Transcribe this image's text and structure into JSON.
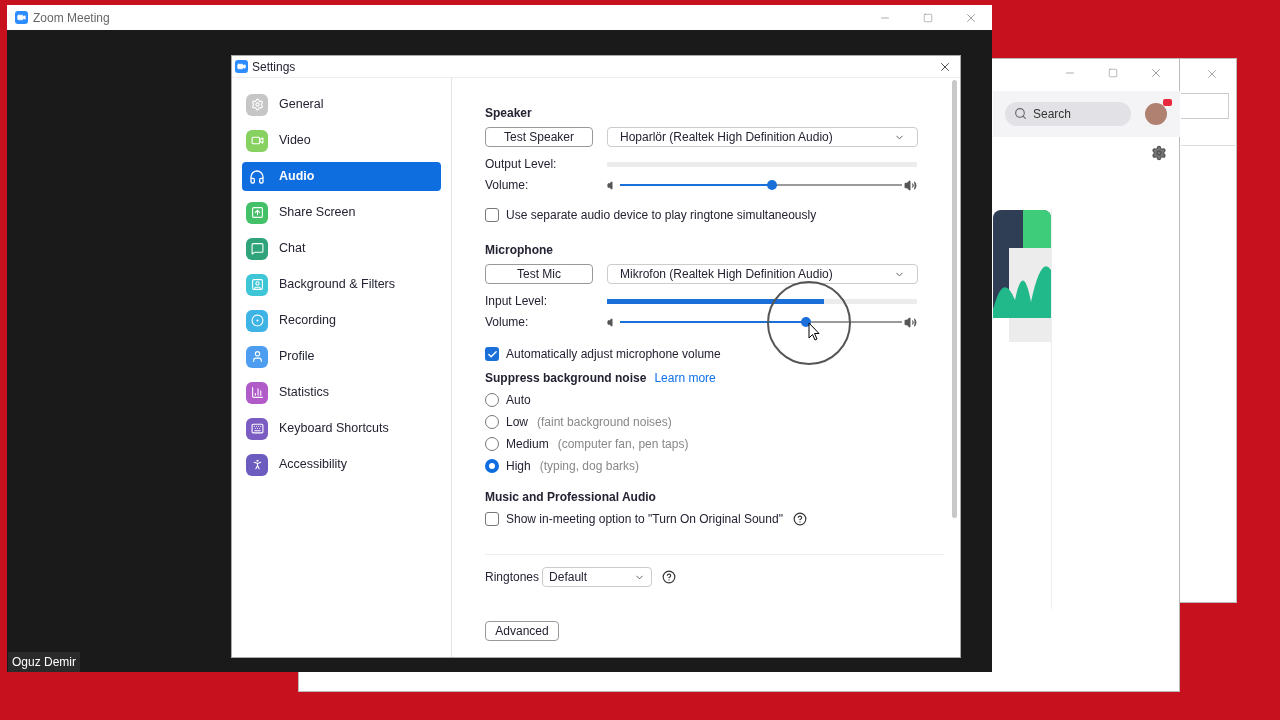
{
  "meeting_window": {
    "title": "Zoom Meeting",
    "participant_name": "Oguz Demir"
  },
  "home_window": {
    "search": {
      "placeholder": "Search"
    }
  },
  "settings": {
    "title": "Settings",
    "sidebar": {
      "items": [
        {
          "label": "General",
          "selected": false,
          "color": "#c6c6c6"
        },
        {
          "label": "Video",
          "selected": false,
          "color": "#86d160"
        },
        {
          "label": "Audio",
          "selected": true
        },
        {
          "label": "Share Screen",
          "selected": false,
          "color": "#44c068"
        },
        {
          "label": "Chat",
          "selected": false,
          "color": "#2fa37a"
        },
        {
          "label": "Background & Filters",
          "selected": false,
          "color": "#3fc6d6"
        },
        {
          "label": "Recording",
          "selected": false,
          "color": "#3db3e6"
        },
        {
          "label": "Profile",
          "selected": false,
          "color": "#4d9ef0"
        },
        {
          "label": "Statistics",
          "selected": false,
          "color": "#b05bc8"
        },
        {
          "label": "Keyboard Shortcuts",
          "selected": false,
          "color": "#7b5cc2"
        },
        {
          "label": "Accessibility",
          "selected": false,
          "color": "#6d5cc0"
        }
      ]
    },
    "speaker": {
      "title": "Speaker",
      "test_button": "Test Speaker",
      "device": "Hoparlör (Realtek High Definition Audio)",
      "output_level": {
        "label": "Output Level:",
        "level": 0
      },
      "volume": {
        "label": "Volume:",
        "level": 0.54
      },
      "separate_ringtone": {
        "label": "Use separate audio device to play ringtone simultaneously",
        "checked": false
      }
    },
    "microphone": {
      "title": "Microphone",
      "test_button": "Test Mic",
      "device": "Mikrofon (Realtek High Definition Audio)",
      "input_level": {
        "label": "Input Level:",
        "level": 0.7
      },
      "volume": {
        "label": "Volume:",
        "level": 0.66
      },
      "auto_adjust": {
        "label": "Automatically adjust microphone volume",
        "checked": true
      }
    },
    "noise_suppression": {
      "title": "Suppress background noise",
      "link": "Learn more",
      "options": [
        {
          "label": "Auto",
          "selected": false
        },
        {
          "label": "Low",
          "hint": "(faint background noises)",
          "selected": false
        },
        {
          "label": "Medium",
          "hint": "(computer fan, pen taps)",
          "selected": false
        },
        {
          "label": "High",
          "hint": "(typing, dog barks)",
          "selected": true
        }
      ]
    },
    "music_audio": {
      "title": "Music and Professional Audio",
      "original_sound": {
        "label": "Show in-meeting option to \"Turn On Original Sound\"",
        "checked": false
      }
    },
    "ringtones": {
      "label": "Ringtones",
      "value": "Default"
    },
    "advanced_button": "Advanced"
  }
}
